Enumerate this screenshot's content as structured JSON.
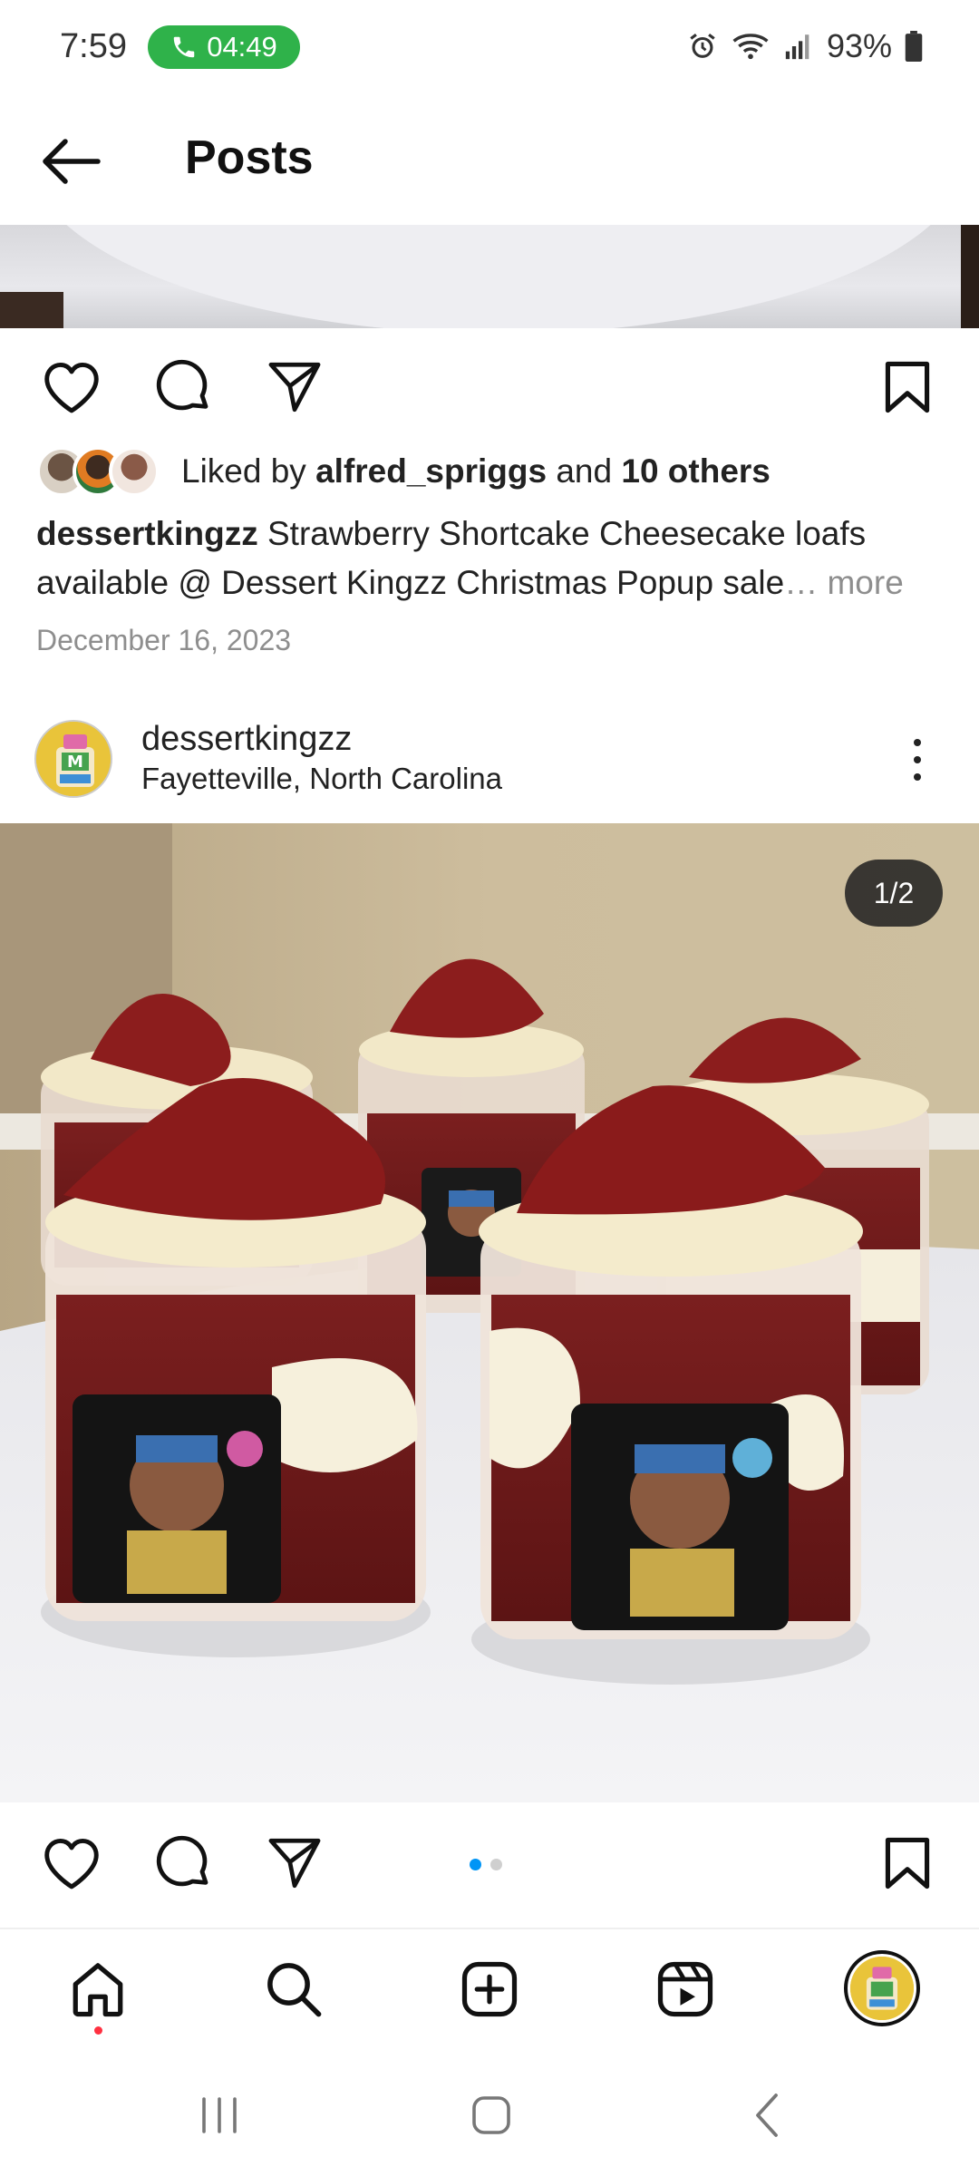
{
  "status_bar": {
    "time": "7:59",
    "call_timer": "04:49",
    "battery": "93%",
    "icons": [
      "alarm-icon",
      "wifi-icon",
      "signal-icon",
      "battery-icon"
    ]
  },
  "header": {
    "title": "Posts",
    "back_icon": "arrow-left-icon"
  },
  "previous_post": {
    "likes": {
      "prefix": "Liked by ",
      "user": "alfred_spriggs",
      "middle": " and ",
      "others": "10 others"
    },
    "caption": {
      "username": "dessertkingzz",
      "text": " Strawberry Shortcake Cheesecake loafs available @ Dessert Kingzz Christmas Popup sale",
      "ellipsis": "… ",
      "more": "more"
    },
    "date": "December 16, 2023"
  },
  "post": {
    "username": "dessertkingzz",
    "location": "Fayetteville, North Carolina",
    "image_counter": "1/2",
    "carousel_count": 2,
    "carousel_active": 0
  },
  "bottom_nav": {
    "items": [
      "home-icon",
      "search-icon",
      "create-icon",
      "reels-icon",
      "profile-avatar"
    ]
  },
  "colors": {
    "accent_blue": "#0095f6",
    "call_green": "#2fb24a",
    "notification_red": "#ff3040"
  }
}
